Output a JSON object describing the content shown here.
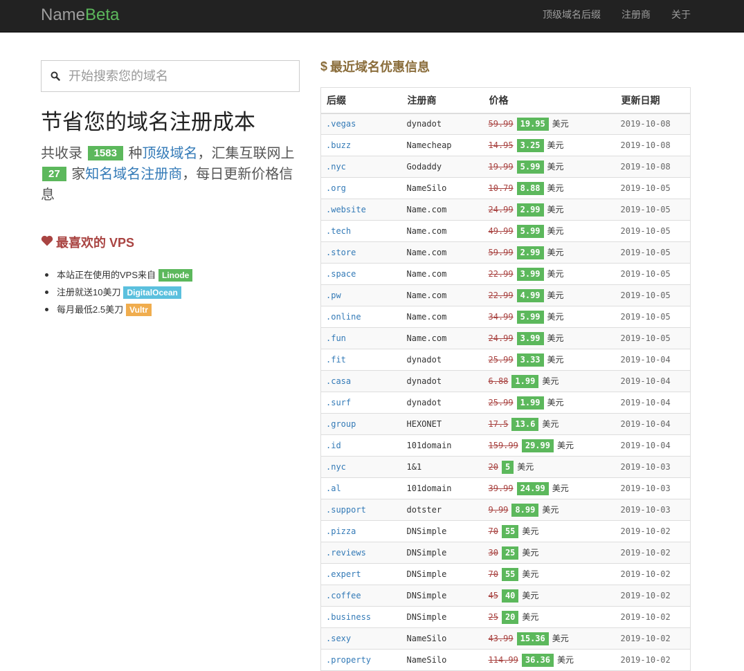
{
  "brand": {
    "part1": "Name",
    "part2": "Beta"
  },
  "nav": [
    {
      "label": "顶级域名后缀"
    },
    {
      "label": "注册商"
    },
    {
      "label": "关于"
    }
  ],
  "search": {
    "placeholder": "开始搜索您的域名"
  },
  "headline": "节省您的域名注册成本",
  "summary": {
    "prefix": "共收录",
    "tld_count": "1583",
    "mid1": "种",
    "tld_link": "顶级域名",
    "mid2": "，汇集互联网上",
    "registrar_count": "27",
    "mid3": "家",
    "registrar_link": "知名域名注册商",
    "suffix": "，每日更新价格信息"
  },
  "vps": {
    "title": "最喜欢的 VPS",
    "items": [
      {
        "text": "本站正在使用的VPS来自",
        "label": "Linode",
        "color": "#5cb85c"
      },
      {
        "text": "注册就送10美刀",
        "label": "DigitalOcean",
        "color": "#5bc0de"
      },
      {
        "text": "每月最低2.5美刀",
        "label": "Vultr",
        "color": "#f0ad4e"
      }
    ]
  },
  "deals": {
    "title": "最近域名优惠信息",
    "headers": {
      "suffix": "后缀",
      "registrar": "注册商",
      "price": "价格",
      "date": "更新日期"
    },
    "unit": "美元",
    "rows": [
      {
        "suffix": ".vegas",
        "registrar": "dynadot",
        "old": "59.99",
        "new": "19.95",
        "date": "2019-10-08"
      },
      {
        "suffix": ".buzz",
        "registrar": "Namecheap",
        "old": "14.95",
        "new": "3.25",
        "date": "2019-10-08"
      },
      {
        "suffix": ".nyc",
        "registrar": "Godaddy",
        "old": "19.99",
        "new": "5.99",
        "date": "2019-10-08"
      },
      {
        "suffix": ".org",
        "registrar": "NameSilo",
        "old": "10.79",
        "new": "8.88",
        "date": "2019-10-05"
      },
      {
        "suffix": ".website",
        "registrar": "Name.com",
        "old": "24.99",
        "new": "2.99",
        "date": "2019-10-05"
      },
      {
        "suffix": ".tech",
        "registrar": "Name.com",
        "old": "49.99",
        "new": "5.99",
        "date": "2019-10-05"
      },
      {
        "suffix": ".store",
        "registrar": "Name.com",
        "old": "59.99",
        "new": "2.99",
        "date": "2019-10-05"
      },
      {
        "suffix": ".space",
        "registrar": "Name.com",
        "old": "22.99",
        "new": "3.99",
        "date": "2019-10-05"
      },
      {
        "suffix": ".pw",
        "registrar": "Name.com",
        "old": "22.99",
        "new": "4.99",
        "date": "2019-10-05"
      },
      {
        "suffix": ".online",
        "registrar": "Name.com",
        "old": "34.99",
        "new": "5.99",
        "date": "2019-10-05"
      },
      {
        "suffix": ".fun",
        "registrar": "Name.com",
        "old": "24.99",
        "new": "3.99",
        "date": "2019-10-05"
      },
      {
        "suffix": ".fit",
        "registrar": "dynadot",
        "old": "25.99",
        "new": "3.33",
        "date": "2019-10-04"
      },
      {
        "suffix": ".casa",
        "registrar": "dynadot",
        "old": "6.88",
        "new": "1.99",
        "date": "2019-10-04"
      },
      {
        "suffix": ".surf",
        "registrar": "dynadot",
        "old": "25.99",
        "new": "1.99",
        "date": "2019-10-04"
      },
      {
        "suffix": ".group",
        "registrar": "HEXONET",
        "old": "17.5",
        "new": "13.6",
        "date": "2019-10-04"
      },
      {
        "suffix": ".id",
        "registrar": "101domain",
        "old": "159.99",
        "new": "29.99",
        "date": "2019-10-04"
      },
      {
        "suffix": ".nyc",
        "registrar": "1&1",
        "old": "20",
        "new": "5",
        "date": "2019-10-03"
      },
      {
        "suffix": ".al",
        "registrar": "101domain",
        "old": "39.99",
        "new": "24.99",
        "date": "2019-10-03"
      },
      {
        "suffix": ".support",
        "registrar": "dotster",
        "old": "9.99",
        "new": "8.99",
        "date": "2019-10-03"
      },
      {
        "suffix": ".pizza",
        "registrar": "DNSimple",
        "old": "70",
        "new": "55",
        "date": "2019-10-02"
      },
      {
        "suffix": ".reviews",
        "registrar": "DNSimple",
        "old": "30",
        "new": "25",
        "date": "2019-10-02"
      },
      {
        "suffix": ".expert",
        "registrar": "DNSimple",
        "old": "70",
        "new": "55",
        "date": "2019-10-02"
      },
      {
        "suffix": ".coffee",
        "registrar": "DNSimple",
        "old": "45",
        "new": "40",
        "date": "2019-10-02"
      },
      {
        "suffix": ".business",
        "registrar": "DNSimple",
        "old": "25",
        "new": "20",
        "date": "2019-10-02"
      },
      {
        "suffix": ".sexy",
        "registrar": "NameSilo",
        "old": "43.99",
        "new": "15.36",
        "date": "2019-10-02"
      },
      {
        "suffix": ".property",
        "registrar": "NameSilo",
        "old": "114.99",
        "new": "36.36",
        "date": "2019-10-02"
      }
    ]
  }
}
